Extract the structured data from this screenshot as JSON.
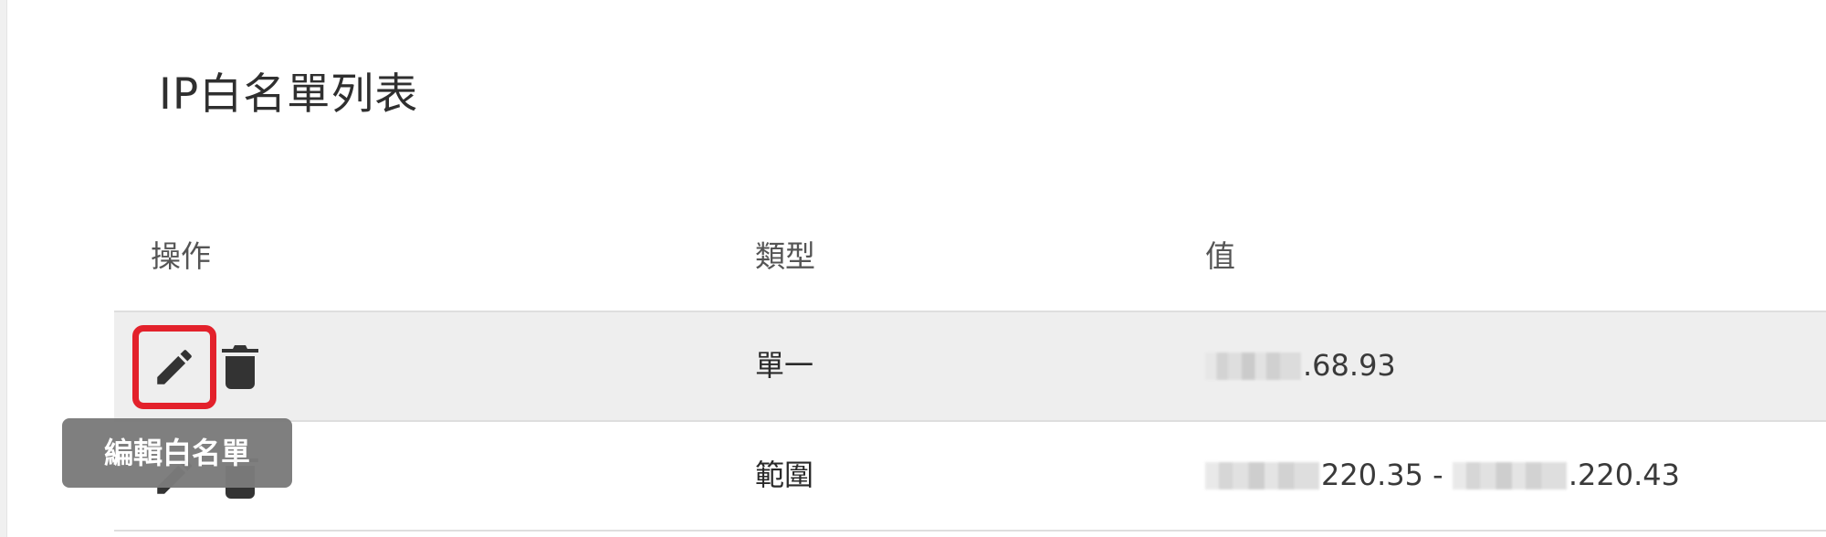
{
  "page": {
    "title": "IP白名單列表"
  },
  "table": {
    "headers": [
      "操作",
      "類型",
      "值"
    ],
    "rows": [
      {
        "type": "單一",
        "value_suffix": ".68.93",
        "value_range_a": "",
        "value_range_b": ""
      },
      {
        "type": "範圍",
        "value_range_a": "220.35 - ",
        "value_range_b": ".220.43"
      }
    ]
  },
  "tooltip": {
    "text": "編輯白名單"
  },
  "icons": {
    "edit": "pencil-icon",
    "delete": "trash-icon"
  },
  "colors": {
    "focus_border": "#e3212b",
    "row_highlight": "#eeeeee",
    "tooltip_bg": "#7b7b7b"
  }
}
